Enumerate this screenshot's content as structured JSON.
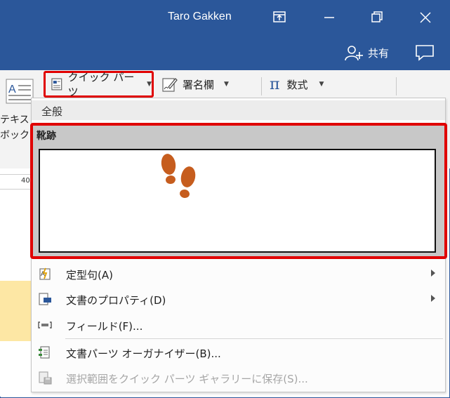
{
  "window": {
    "user_name": "Taro Gakken",
    "share_label": "共有",
    "colors": {
      "titlebar": "#2b579a",
      "highlight": "#e00000",
      "icon_accent": "#2b579a",
      "footprints": "#c65d1e"
    }
  },
  "ribbon": {
    "textbox_label_line1": "テキスト",
    "textbox_label_line2": "ボックス",
    "quick_parts_label": "クイック パーツ",
    "signature_label": "署名欄",
    "equation_label": "数式",
    "ruler_value": "40"
  },
  "dropdown": {
    "section_title": "全般",
    "gallery_item_name": "靴跡",
    "menu_items": [
      {
        "label": "定型句(A)",
        "icon": "autotext-icon",
        "has_submenu": true,
        "enabled": true
      },
      {
        "label": "文書のプロパティ(D)",
        "icon": "document-property-icon",
        "has_submenu": true,
        "enabled": true
      },
      {
        "label": "フィールド(F)...",
        "icon": "field-icon",
        "has_submenu": false,
        "enabled": true
      },
      {
        "label": "文書パーツ オーガナイザー(B)...",
        "icon": "building-blocks-organizer-icon",
        "has_submenu": false,
        "enabled": true
      },
      {
        "label": "選択範囲をクイック パーツ ギャラリーに保存(S)...",
        "icon": "save-to-gallery-icon",
        "has_submenu": false,
        "enabled": false
      }
    ]
  }
}
